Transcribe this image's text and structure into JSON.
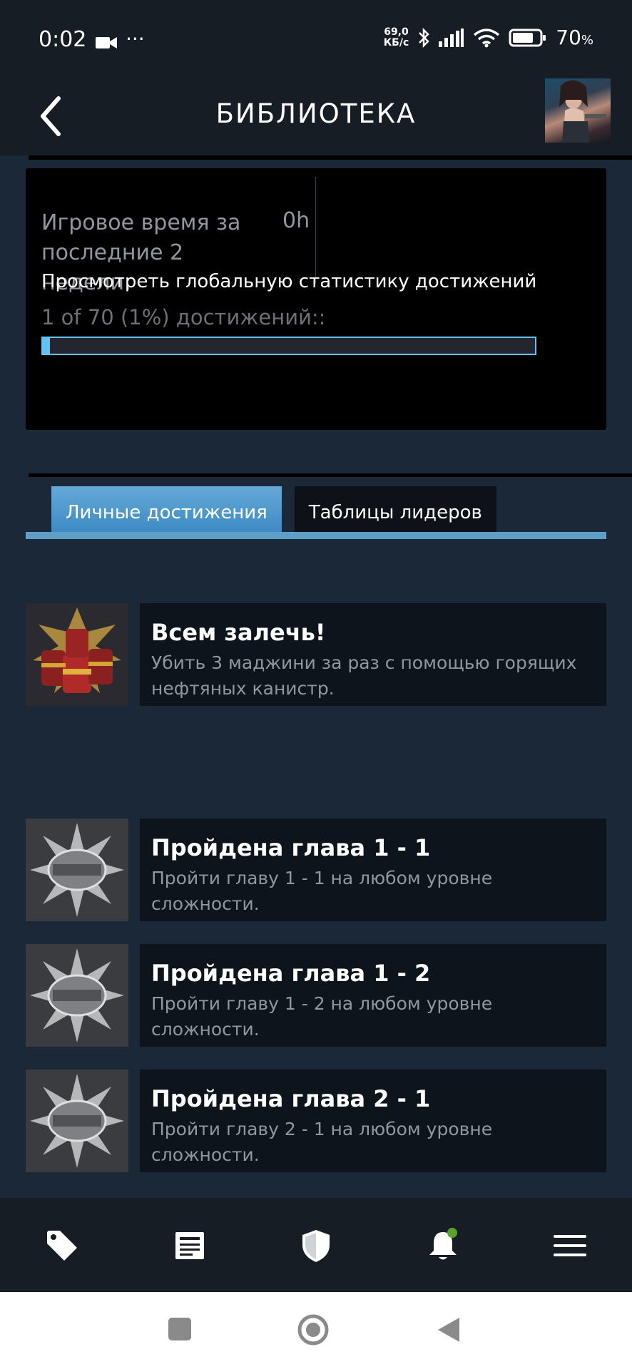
{
  "status_bar": {
    "time": "0:02",
    "dots": "···",
    "speed_value": "69,0",
    "speed_unit": "КБ/с",
    "battery": "70",
    "battery_unit": "%"
  },
  "header": {
    "title": "БИБЛИОТЕКА"
  },
  "stats": {
    "playtime_label": "Игровое время за последние 2 недели:",
    "playtime_value": "0h",
    "global_link": "Просмотреть глобальную статистику достижений",
    "achievements_count": "1 of 70 (1%) достижений::",
    "progress_fraction": 0.014
  },
  "tabs": [
    {
      "label": "Личные достижения",
      "active": true
    },
    {
      "label": "Таблицы лидеров",
      "active": false
    }
  ],
  "achievements": [
    {
      "title": "Всем залечь!",
      "desc": "Убить 3 маджини за раз с помощью горящих нефтяных канистр.",
      "icon": "barrels-icon"
    },
    {
      "title": "Пройдена глава 1 - 1",
      "desc": "Пройти главу 1 - 1 на любом уровне сложности.",
      "icon": "bsaa-emblem-icon"
    },
    {
      "title": "Пройдена глава 1 - 2",
      "desc": "Пройти главу 1 - 2 на любом уровне сложности.",
      "icon": "bsaa-emblem-icon"
    },
    {
      "title": "Пройдена глава 2 - 1",
      "desc": "Пройти главу 2 - 1 на любом уровне сложности.",
      "icon": "bsaa-emblem-icon"
    }
  ],
  "bottom_nav": [
    "tag-icon",
    "news-icon",
    "shield-icon",
    "bell-icon",
    "menu-icon"
  ],
  "colors": {
    "accent": "#66c0f4",
    "background": "#1b2838",
    "notification_dot": "#5ba32b"
  }
}
